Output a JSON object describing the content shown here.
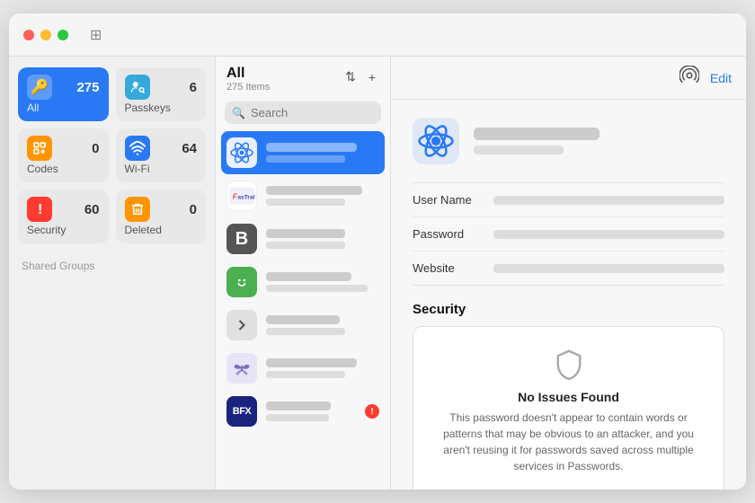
{
  "window": {
    "traffic_lights": [
      "red",
      "yellow",
      "green"
    ]
  },
  "sidebar": {
    "tiles": [
      {
        "id": "all",
        "label": "All",
        "count": "275",
        "icon": "key",
        "style": "all",
        "active": true
      },
      {
        "id": "passkeys",
        "label": "Passkeys",
        "count": "6",
        "icon": "person-circle",
        "style": "default"
      },
      {
        "id": "codes",
        "label": "Codes",
        "count": "0",
        "icon": "grid",
        "style": "orange"
      },
      {
        "id": "wifi",
        "label": "Wi-Fi",
        "count": "64",
        "icon": "wifi",
        "style": "blue-wifi"
      },
      {
        "id": "security",
        "label": "Security",
        "count": "60",
        "icon": "exclamation",
        "style": "red",
        "badge": true
      },
      {
        "id": "deleted",
        "label": "Deleted",
        "count": "0",
        "icon": "trash",
        "style": "yellow"
      }
    ],
    "shared_groups_label": "Shared Groups"
  },
  "list_column": {
    "title": "All",
    "subtitle": "275 Items",
    "sort_button": "⇅",
    "add_button": "+",
    "search_placeholder": "Search",
    "items": [
      {
        "id": "item1",
        "icon": "atom",
        "active": true,
        "has_badge": false
      },
      {
        "id": "item2",
        "icon": "fastrak",
        "active": false,
        "has_badge": false
      },
      {
        "id": "item3",
        "icon": "b",
        "active": false,
        "has_badge": false
      },
      {
        "id": "item4",
        "icon": "smile",
        "active": false,
        "has_badge": false
      },
      {
        "id": "item5",
        "icon": "chevron",
        "active": false,
        "has_badge": false
      },
      {
        "id": "item6",
        "icon": "butterfly",
        "active": false,
        "has_badge": false
      },
      {
        "id": "item7",
        "icon": "bfx",
        "active": false,
        "has_badge": true
      }
    ]
  },
  "detail": {
    "edit_button_label": "Edit",
    "fields": [
      {
        "label": "User Name"
      },
      {
        "label": "Password"
      },
      {
        "label": "Website"
      }
    ],
    "security_section": {
      "title": "Security",
      "card_title": "No Issues Found",
      "card_description": "This password doesn't appear to contain words or patterns that may be obvious to an attacker, and you aren't reusing it for passwords saved across multiple services in Passwords."
    }
  }
}
